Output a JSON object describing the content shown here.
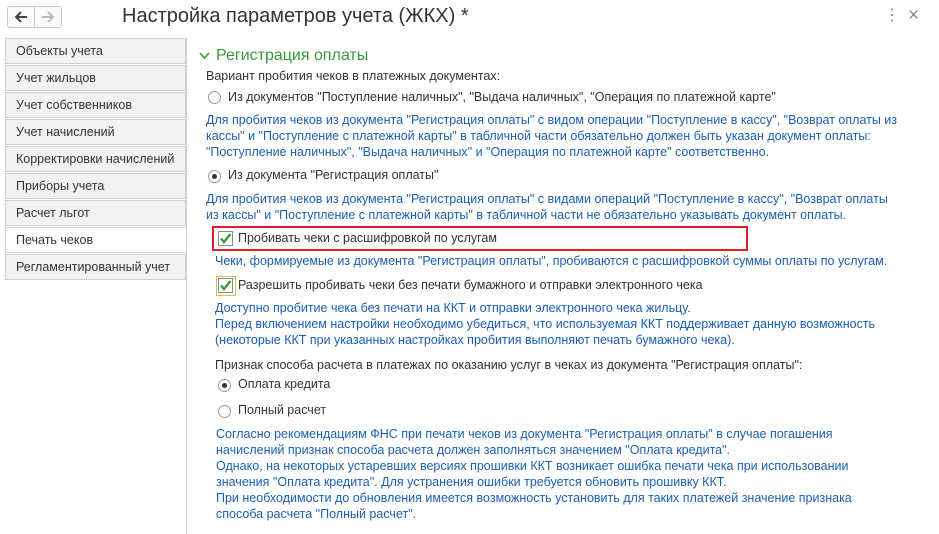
{
  "window": {
    "title": "Настройка параметров учета (ЖКХ) *",
    "more_icon": "kebab-icon",
    "close_icon": "close-icon"
  },
  "sidebar": {
    "items": [
      {
        "label": "Объекты учета"
      },
      {
        "label": "Учет жильцов"
      },
      {
        "label": "Учет собственников"
      },
      {
        "label": "Учет начислений"
      },
      {
        "label": "Корректировки начислений"
      },
      {
        "label": "Приборы учета"
      },
      {
        "label": "Расчет льгот"
      },
      {
        "label": "Печать чеков",
        "active": true
      },
      {
        "label": "Регламентированный учет"
      }
    ]
  },
  "section": {
    "title": "Регистрация оплаты",
    "variant_label": "Вариант пробития чеков в платежных документах:",
    "option1": {
      "label": "Из документов \"Поступление наличных\", \"Выдача наличных\", \"Операция по платежной карте\"",
      "selected": false,
      "hint_lines": [
        "Для пробития чеков из документа \"Регистрация оплаты\" с видом операции \"Поступление в кассу\", \"Возврат оплаты из",
        "кассы\" и \"Поступление с платежной карты\" в табличной части обязательно должен быть указан документ оплаты:",
        "\"Поступление наличных\", \"Выдача наличных\" и \"Операция по платежной карте\" соответственно."
      ]
    },
    "option2": {
      "label": "Из документа \"Регистрация оплаты\"",
      "selected": true,
      "hint_lines": [
        "Для пробития чеков из документа \"Регистрация оплаты\" с видами операций \"Поступление в кассу\", \"Возврат оплаты",
        "из кассы\" и \"Поступление с платежной карты\" в табличной части не обязательно указывать документ оплаты."
      ]
    },
    "check1": {
      "label": "Пробивать чеки с расшифровкой по услугам",
      "checked": true,
      "hint": "Чеки, формируемые из документа \"Регистрация оплаты\", пробиваются с расшифровкой суммы оплаты по услугам."
    },
    "check2": {
      "label": "Разрешить пробивать чеки без печати бумажного и отправки электронного чека",
      "checked": true,
      "hint_lines": [
        "Доступно пробитие чека без печати на ККТ и отправки электронного чека жильцу.",
        "Перед включением настройки необходимо убедиться, что используемая ККТ поддерживает данную возможность",
        "(некоторые ККТ при указанных настройках пробития выполняют печать бумажного чека)."
      ]
    },
    "payment_method_label": "Признак способа расчета в платежах по оказанию услуг в чеках из документа \"Регистрация оплаты\":",
    "payment_options": [
      {
        "label": "Оплата кредита",
        "selected": true
      },
      {
        "label": "Полный расчет",
        "selected": false
      }
    ],
    "bottom_note_lines": [
      "Согласно рекомендациям ФНС при печати чеков из документа \"Регистрация оплаты\" в случае погашения",
      "начислений признак способа расчета должен заполняться значением \"Оплата кредита\".",
      "Однако, на некоторых устаревших версиях прошивки ККТ возникает ошибка печати чека при использовании",
      "значения \"Оплата кредита\". Для устранения ошибки требуется обновить прошивку ККТ.",
      "При необходимости до обновления имеется возможность установить для таких платежей значение признака",
      "способа расчета \"Полный расчет\"."
    ]
  },
  "colors": {
    "accent_green": "#3a9a3a",
    "hint_blue": "#1b5fb3",
    "highlight_red": "#e21f26"
  }
}
